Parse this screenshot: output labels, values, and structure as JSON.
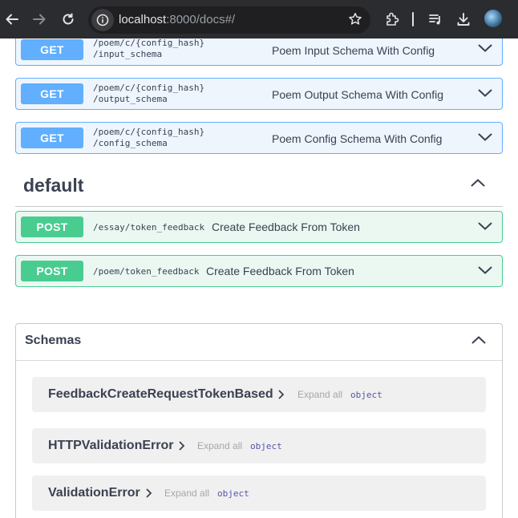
{
  "browser": {
    "url_host": "localhost",
    "url_rest": ":8000/docs#/",
    "icons": [
      "back-arrow-icon",
      "forward-arrow-icon",
      "reload-icon",
      "site-info-icon",
      "bookmark-star-icon",
      "extensions-icon",
      "media-controls-icon",
      "download-icon",
      "profile-avatar"
    ]
  },
  "operations_top": [
    {
      "method": "GET",
      "path_line1": "/poem/c/{config_hash}",
      "path_line2": "/input_schema",
      "summary": "Poem Input Schema With Config"
    },
    {
      "method": "GET",
      "path_line1": "/poem/c/{config_hash}",
      "path_line2": "/output_schema",
      "summary": "Poem Output Schema With Config"
    },
    {
      "method": "GET",
      "path_line1": "/poem/c/{config_hash}",
      "path_line2": "/config_schema",
      "summary": "Poem Config Schema With Config"
    }
  ],
  "default_tag": {
    "name": "default",
    "operations": [
      {
        "method": "POST",
        "path": "/essay/token_feedback",
        "summary": "Create Feedback From Token"
      },
      {
        "method": "POST",
        "path": "/poem/token_feedback",
        "summary": "Create Feedback From Token"
      }
    ]
  },
  "schemas": {
    "title": "Schemas",
    "items": [
      {
        "name": "FeedbackCreateRequestTokenBased",
        "expand": "Expand all",
        "type": "object"
      },
      {
        "name": "HTTPValidationError",
        "expand": "Expand all",
        "type": "object"
      },
      {
        "name": "ValidationError",
        "expand": "Expand all",
        "type": "object"
      }
    ]
  },
  "colors": {
    "get": "#61affe",
    "post": "#49cc90",
    "chrome_bg": "#2b2c30",
    "text": "#3b4151"
  }
}
